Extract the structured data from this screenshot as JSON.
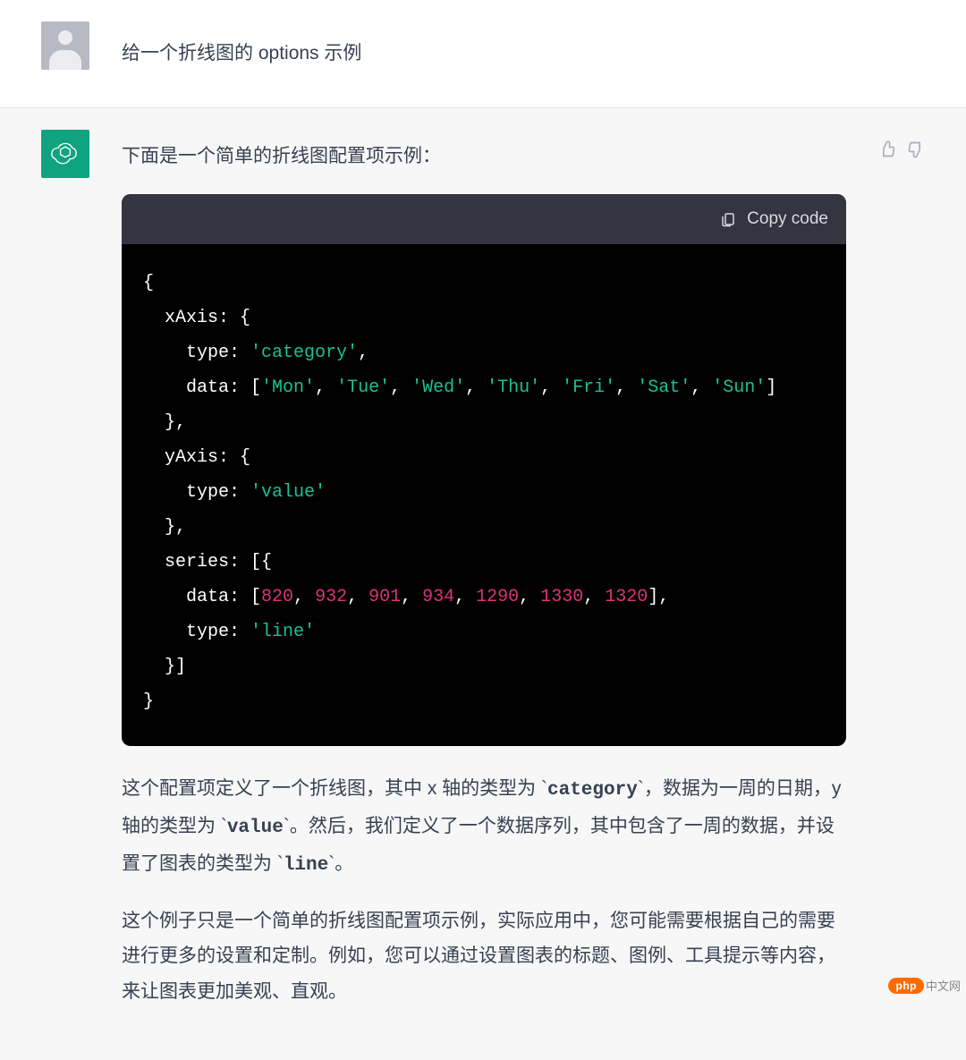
{
  "user": {
    "message": "给一个折线图的 options  示例"
  },
  "assistant": {
    "intro": "下面是一个简单的折线图配置项示例：",
    "code": {
      "copy_label": "Copy code",
      "tokens": [
        {
          "t": "{",
          "c": "punc"
        },
        {
          "t": "\n",
          "c": "punc"
        },
        {
          "t": "  xAxis",
          "c": "prop"
        },
        {
          "t": ": {",
          "c": "punc"
        },
        {
          "t": "\n",
          "c": "punc"
        },
        {
          "t": "    type",
          "c": "prop"
        },
        {
          "t": ": ",
          "c": "punc"
        },
        {
          "t": "'category'",
          "c": "str"
        },
        {
          "t": ",",
          "c": "punc"
        },
        {
          "t": "\n",
          "c": "punc"
        },
        {
          "t": "    data",
          "c": "prop"
        },
        {
          "t": ": [",
          "c": "punc"
        },
        {
          "t": "'Mon'",
          "c": "str"
        },
        {
          "t": ", ",
          "c": "punc"
        },
        {
          "t": "'Tue'",
          "c": "str"
        },
        {
          "t": ", ",
          "c": "punc"
        },
        {
          "t": "'Wed'",
          "c": "str"
        },
        {
          "t": ", ",
          "c": "punc"
        },
        {
          "t": "'Thu'",
          "c": "str"
        },
        {
          "t": ", ",
          "c": "punc"
        },
        {
          "t": "'Fri'",
          "c": "str"
        },
        {
          "t": ", ",
          "c": "punc"
        },
        {
          "t": "'Sat'",
          "c": "str"
        },
        {
          "t": ", ",
          "c": "punc"
        },
        {
          "t": "'Sun'",
          "c": "str"
        },
        {
          "t": "]",
          "c": "punc"
        },
        {
          "t": "\n",
          "c": "punc"
        },
        {
          "t": "  },",
          "c": "punc"
        },
        {
          "t": "\n",
          "c": "punc"
        },
        {
          "t": "  yAxis",
          "c": "prop"
        },
        {
          "t": ": {",
          "c": "punc"
        },
        {
          "t": "\n",
          "c": "punc"
        },
        {
          "t": "    type",
          "c": "prop"
        },
        {
          "t": ": ",
          "c": "punc"
        },
        {
          "t": "'value'",
          "c": "str"
        },
        {
          "t": "\n",
          "c": "punc"
        },
        {
          "t": "  },",
          "c": "punc"
        },
        {
          "t": "\n",
          "c": "punc"
        },
        {
          "t": "  series",
          "c": "prop"
        },
        {
          "t": ": [{",
          "c": "punc"
        },
        {
          "t": "\n",
          "c": "punc"
        },
        {
          "t": "    data",
          "c": "prop"
        },
        {
          "t": ": [",
          "c": "punc"
        },
        {
          "t": "820",
          "c": "num"
        },
        {
          "t": ", ",
          "c": "punc"
        },
        {
          "t": "932",
          "c": "num"
        },
        {
          "t": ", ",
          "c": "punc"
        },
        {
          "t": "901",
          "c": "num"
        },
        {
          "t": ", ",
          "c": "punc"
        },
        {
          "t": "934",
          "c": "num"
        },
        {
          "t": ", ",
          "c": "punc"
        },
        {
          "t": "1290",
          "c": "num"
        },
        {
          "t": ", ",
          "c": "punc"
        },
        {
          "t": "1330",
          "c": "num"
        },
        {
          "t": ", ",
          "c": "punc"
        },
        {
          "t": "1320",
          "c": "num"
        },
        {
          "t": "],",
          "c": "punc"
        },
        {
          "t": "\n",
          "c": "punc"
        },
        {
          "t": "    type",
          "c": "prop"
        },
        {
          "t": ": ",
          "c": "punc"
        },
        {
          "t": "'line'",
          "c": "str"
        },
        {
          "t": "\n",
          "c": "punc"
        },
        {
          "t": "  }]",
          "c": "punc"
        },
        {
          "t": "\n",
          "c": "punc"
        },
        {
          "t": "}",
          "c": "punc"
        }
      ]
    },
    "desc1_parts": [
      {
        "kind": "text",
        "v": "这个配置项定义了一个折线图，其中 x 轴的类型为 `"
      },
      {
        "kind": "code",
        "v": "category"
      },
      {
        "kind": "text",
        "v": "`，数据为一周的日期，y 轴的类型为 `"
      },
      {
        "kind": "code",
        "v": "value"
      },
      {
        "kind": "text",
        "v": "`。然后，我们定义了一个数据序列，其中包含了一周的数据，并设置了图表的类型为 `"
      },
      {
        "kind": "code",
        "v": "line"
      },
      {
        "kind": "text",
        "v": "`。"
      }
    ],
    "desc2": "这个例子只是一个简单的折线图配置项示例，实际应用中，您可能需要根据自己的需要进行更多的设置和定制。例如，您可以通过设置图表的标题、图例、工具提示等内容，来让图表更加美观、直观。"
  },
  "watermark": {
    "badge": "php",
    "text": "中文网"
  }
}
